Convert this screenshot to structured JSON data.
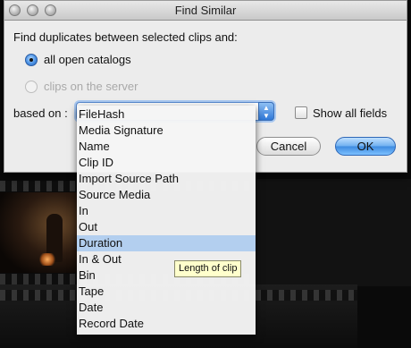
{
  "window": {
    "title": "Find Similar"
  },
  "dialog": {
    "prompt": "Find duplicates between selected clips and:",
    "options": [
      {
        "label": "all open catalogs",
        "selected": true,
        "enabled": true
      },
      {
        "label": "clips on the server",
        "selected": false,
        "enabled": false
      }
    ],
    "based_on_label": "based on :",
    "show_all_fields_label": "Show all fields",
    "show_all_fields_checked": false,
    "cancel_label": "Cancel",
    "ok_label": "OK"
  },
  "dropdown": {
    "items": [
      "FileHash",
      "Media Signature",
      "Name",
      "Clip ID",
      "Import Source Path",
      "Source Media",
      "In",
      "Out",
      "Duration",
      "In & Out",
      "Bin",
      "Tape",
      "Date",
      "Record Date"
    ],
    "highlighted_item": "Duration"
  },
  "tooltip": {
    "text": "Length of clip"
  },
  "colors": {
    "highlight": "#b3cfef",
    "ok_button": "#3d8ae0",
    "tooltip_bg": "#ffffcc"
  }
}
